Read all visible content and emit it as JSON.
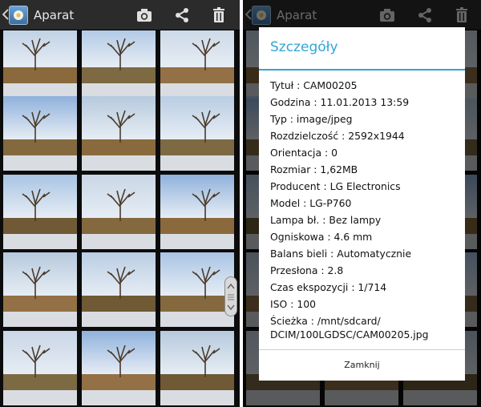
{
  "actionbar": {
    "title": "Aparat",
    "icons": [
      "back-chevron-icon",
      "app-icon",
      "camera-icon",
      "share-icon",
      "trash-icon"
    ]
  },
  "gallery": {
    "tiles": [
      "photo-tree-dry-grass",
      "photo-trees-field",
      "photo-tree-wide",
      "photo-tree-sunny",
      "photo-tree-sunny",
      "photo-tree-sunny",
      "photo-tree-snow-field",
      "photo-tree-field",
      "photo-tree-bare-branches",
      "photo-tree-leaning",
      "photo-tree-clouds",
      "photo-snowy-path",
      "photo-tree-leaning-close",
      "photo-clouds",
      "photo-tree-stump"
    ]
  },
  "dialog": {
    "title": "Szczegóły",
    "details": [
      "Tytuł : CAM00205",
      "Godzina : 11.01.2013 13:59",
      "Typ : image/jpeg",
      "Rozdzielczość : 2592x1944",
      "Orientacja : 0",
      "Rozmiar : 1,62MB",
      "Producent : LG Electronics",
      "Model : LG-P760",
      "Lampa bł. : Bez lampy",
      "Ogniskowa : 4.6 mm",
      "Balans bieli : Automatycznie",
      "Przesłona : 2.8",
      "Czas ekspozycji : 1/714",
      "ISO : 100"
    ],
    "path": "Ścieżka : /mnt/sdcard/ DCIM/100LGDSC/CAM00205.jpg",
    "close_label": "Zamknij"
  },
  "colors": {
    "accent": "#33a4d8",
    "actionbar": "#2b2b2b",
    "dialog_bg": "#ffffff"
  }
}
